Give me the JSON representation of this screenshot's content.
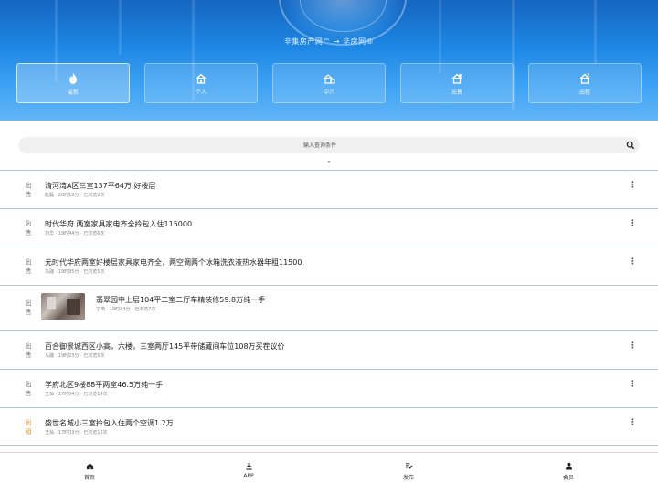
{
  "header": {
    "site_title": "辛集房产网™ → 辛房网®"
  },
  "tabs": [
    {
      "label": "最新",
      "icon": "fire-icon",
      "active": true
    },
    {
      "label": "个人",
      "icon": "home-icon",
      "active": false
    },
    {
      "label": "中介",
      "icon": "building-icon",
      "active": false
    },
    {
      "label": "出售",
      "icon": "home-sale-icon",
      "active": false
    },
    {
      "label": "出租",
      "icon": "home-rent-icon",
      "active": false
    }
  ],
  "search": {
    "placeholder": "输入查询条件"
  },
  "listings": [
    {
      "cat": [
        "出",
        "售"
      ],
      "type": "sale",
      "title": "清河湾A区三室137平64万 好楼层",
      "meta": "赵磊 · 20时19分 · 已浏览2次",
      "has_image": false
    },
    {
      "cat": [
        "出",
        "售"
      ],
      "type": "sale",
      "title": "时代华府 两室家具家电齐全拎包入住115000",
      "meta": "刘华 · 19时44分 · 已浏览6次",
      "has_image": false
    },
    {
      "cat": [
        "出",
        "售"
      ],
      "type": "sale",
      "title": "元时代华府两室好楼层家具家电齐全，两空调两个冰箱洗衣液热水器年租11500",
      "meta": "马骊 · 19时35分 · 已浏览5次",
      "has_image": false
    },
    {
      "cat": [
        "出",
        "售"
      ],
      "type": "sale",
      "title": "翡翠园中上层104平二室二厅车精装修59.8万纯一手",
      "meta": "丁雨 · 19时34分 · 已浏览7次",
      "has_image": true
    },
    {
      "cat": [
        "出",
        "售"
      ],
      "type": "sale",
      "title": "百合御景城西区小高，六楼，三室两厅145平带储藏间车位108万买茬议价",
      "meta": "马骊 · 19时23分 · 已浏览5次",
      "has_image": false
    },
    {
      "cat": [
        "出",
        "售"
      ],
      "type": "sale",
      "title": "学府北区9楼88平两室46.5万纯一手",
      "meta": "王灿 · 17时04分 · 已浏览14次",
      "has_image": false
    },
    {
      "cat": [
        "出",
        "租"
      ],
      "type": "rent",
      "title": "盛世名城小三室拎包入住两个空调1.2万",
      "meta": "王灿 · 17时03分 · 已浏览12次",
      "has_image": false
    }
  ],
  "bottom_nav": [
    {
      "label": "首页",
      "icon": "home-icon"
    },
    {
      "label": "APP",
      "icon": "download-icon"
    },
    {
      "label": "发布",
      "icon": "edit-icon"
    },
    {
      "label": "会员",
      "icon": "user-icon"
    }
  ],
  "colors": {
    "banner": "#1e88e5",
    "rent_accent": "#e08a1e",
    "divider": "#b3c6d6"
  }
}
